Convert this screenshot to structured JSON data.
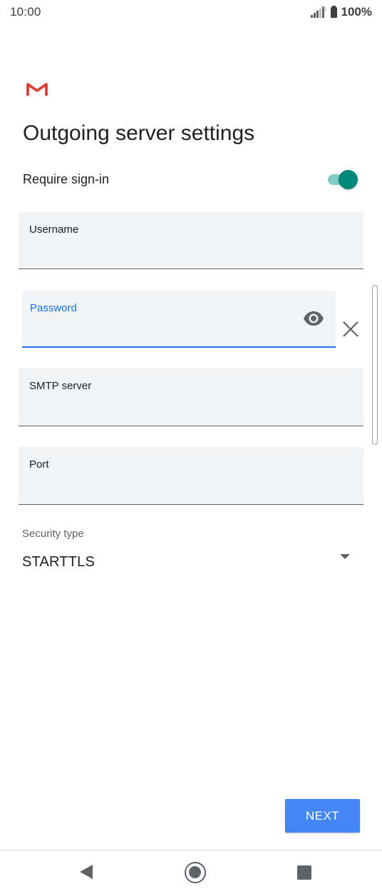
{
  "status_bar": {
    "time": "10:00",
    "battery": "100%",
    "icons": [
      "signal-icon",
      "battery-icon"
    ]
  },
  "app": {
    "logo_icon": "gmail-logo-icon",
    "brand_color": "#d93025"
  },
  "page": {
    "title": "Outgoing server settings"
  },
  "require_signin": {
    "label": "Require sign-in",
    "enabled": true,
    "accent": "#00897b"
  },
  "fields": {
    "username": {
      "label": "Username",
      "value": ""
    },
    "password": {
      "label": "Password",
      "value": "",
      "focused": true,
      "accent": "#1a73e8"
    },
    "smtp_server": {
      "label": "SMTP server",
      "value": ""
    },
    "port": {
      "label": "Port",
      "value": ""
    }
  },
  "security": {
    "label": "Security type",
    "value": "STARTTLS"
  },
  "actions": {
    "next_label": "NEXT",
    "next_color": "#4285f4"
  },
  "nav": {
    "icons": [
      "back-icon",
      "home-icon",
      "recents-icon"
    ]
  }
}
